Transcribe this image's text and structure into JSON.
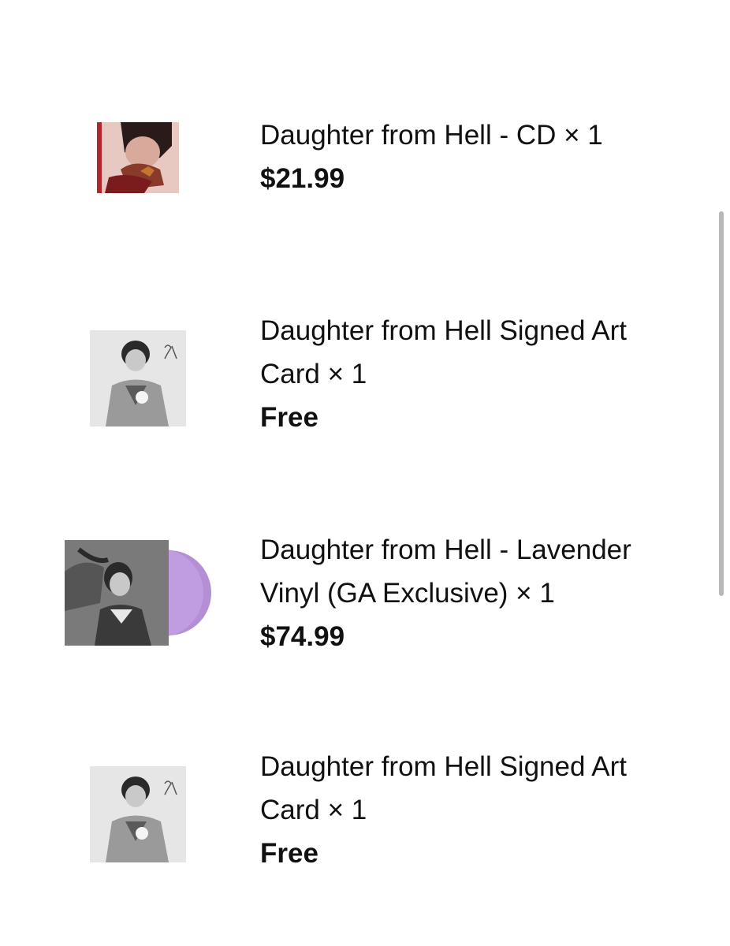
{
  "order_items": [
    {
      "title": "Daughter from Hell - CD × 1",
      "price": "$21.99",
      "thumbnail": "cd-cover-art",
      "thumbnail_accent": "#b0282e"
    },
    {
      "title": "Daughter from Hell Signed Art Card × 1",
      "price": "Free",
      "thumbnail": "signed-art-card",
      "thumbnail_accent": "#d9d9d9"
    },
    {
      "title": "Daughter from Hell - Lavender Vinyl (GA Exclusive) × 1",
      "price": "$74.99",
      "thumbnail": "lavender-vinyl",
      "thumbnail_accent": "#b58fd6"
    },
    {
      "title": "Daughter from Hell Signed Art Card × 1",
      "price": "Free",
      "thumbnail": "signed-art-card",
      "thumbnail_accent": "#d9d9d9"
    }
  ]
}
